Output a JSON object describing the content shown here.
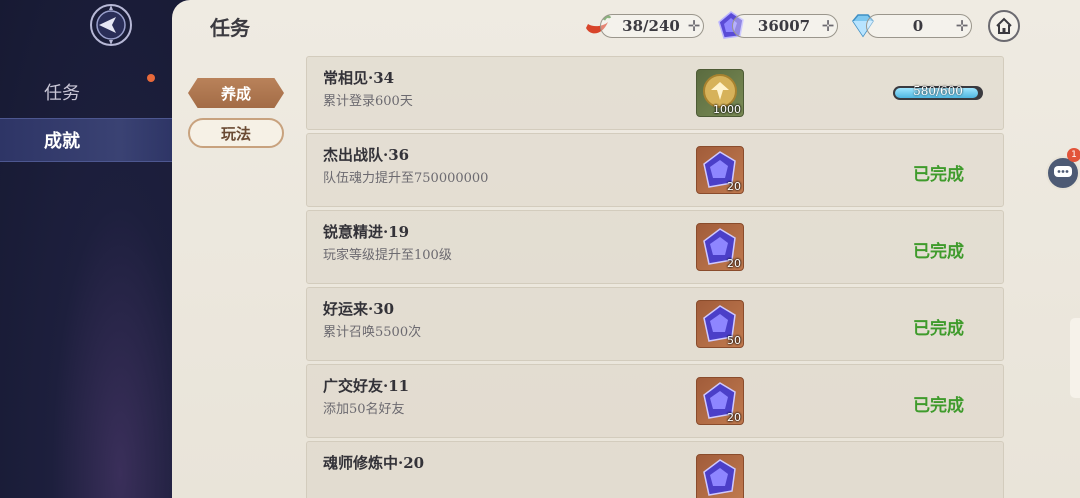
{
  "sidebar": {
    "items": [
      {
        "label": "任务",
        "active": false,
        "badge": true
      },
      {
        "label": "成就",
        "active": true
      }
    ]
  },
  "header": {
    "title": "任务",
    "currencies": [
      {
        "icon": "pepper-icon",
        "value": "38/240"
      },
      {
        "icon": "purple-crystal-icon",
        "value": "36007"
      },
      {
        "icon": "diamond-icon",
        "value": "0"
      }
    ],
    "home_icon": "home-icon"
  },
  "categories": [
    {
      "label": "养成",
      "active": true
    },
    {
      "label": "玩法",
      "active": false
    }
  ],
  "achievements": [
    {
      "name": "常相见·34",
      "desc": "累计登录600天",
      "reward_icon": "gold-coin-icon",
      "reward_qty": "1000",
      "status": "progress",
      "progress_text": "580/600",
      "progress": 0.967
    },
    {
      "name": "杰出战队·36",
      "desc": "队伍魂力提升至750000000",
      "reward_icon": "purple-crystal-icon",
      "reward_qty": "20",
      "status": "已完成"
    },
    {
      "name": "锐意精进·19",
      "desc": "玩家等级提升至100级",
      "reward_icon": "purple-crystal-icon",
      "reward_qty": "20",
      "status": "已完成"
    },
    {
      "name": "好运来·30",
      "desc": "累计召唤5500次",
      "reward_icon": "purple-crystal-icon",
      "reward_qty": "50",
      "status": "已完成"
    },
    {
      "name": "广交好友·11",
      "desc": "添加50名好友",
      "reward_icon": "purple-crystal-icon",
      "reward_qty": "20",
      "status": "已完成"
    },
    {
      "name": "魂师修炼中·20",
      "desc": "",
      "reward_icon": "purple-crystal-icon",
      "reward_qty": "",
      "status": ""
    }
  ],
  "chat": {
    "badge": "1",
    "icon": "chat-icon"
  },
  "colors": {
    "done": "#3f9b2c",
    "active_tab": "#a36c46",
    "progress_fill": "#4fb6e0"
  }
}
